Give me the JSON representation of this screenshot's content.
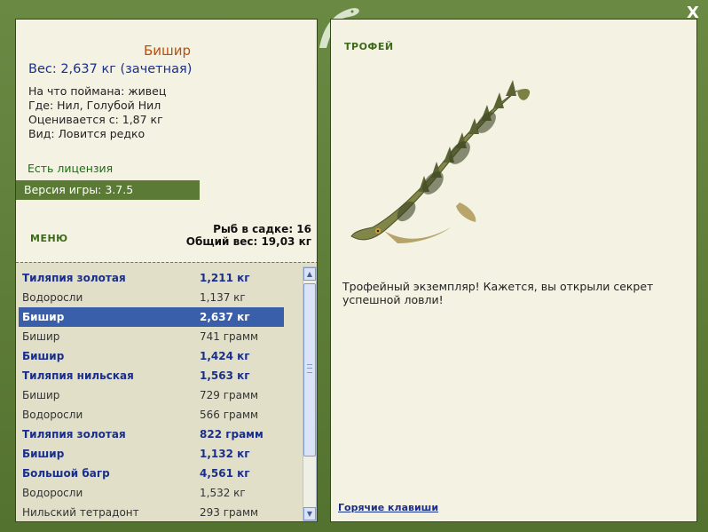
{
  "window": {
    "close_label": "X"
  },
  "fish": {
    "name": "Бишир",
    "weight": "Вес: 2,637 кг (зачетная)",
    "bait": "На что поймана: живец",
    "location": "Где: Нил, Голубой Нил",
    "value": "Оценивается с: 1,87 кг",
    "rarity": "Вид: Ловится редко"
  },
  "license": "Есть лицензия",
  "version": "Версия игры: 3.7.5",
  "menu_label": "МЕНЮ",
  "keepnet": {
    "count": "Рыб в садке: 16",
    "total": "Общий вес: 19,03 кг"
  },
  "catch_list": [
    {
      "name": "Тиляпия золотая",
      "weight": "1,211 кг",
      "style": "b"
    },
    {
      "name": "Водоросли",
      "weight": "1,137 кг",
      "style": "n"
    },
    {
      "name": "Бишир",
      "weight": "2,637 кг",
      "style": "sel"
    },
    {
      "name": "Бишир",
      "weight": "741 грамм",
      "style": "n"
    },
    {
      "name": "Бишир",
      "weight": "1,424 кг",
      "style": "b"
    },
    {
      "name": "Тиляпия нильская",
      "weight": "1,563 кг",
      "style": "b"
    },
    {
      "name": "Бишир",
      "weight": "729 грамм",
      "style": "n"
    },
    {
      "name": "Водоросли",
      "weight": "566 грамм",
      "style": "n"
    },
    {
      "name": "Тиляпия золотая",
      "weight": "822 грамм",
      "style": "b"
    },
    {
      "name": "Бишир",
      "weight": "1,132 кг",
      "style": "b"
    },
    {
      "name": "Большой багр",
      "weight": "4,561 кг",
      "style": "b"
    },
    {
      "name": "Водоросли",
      "weight": "1,532 кг",
      "style": "n"
    },
    {
      "name": "Нильский тетрадонт",
      "weight": "293 грамм",
      "style": "n"
    }
  ],
  "trophy": {
    "label": "ТРОФЕЙ",
    "text": "Трофейный экземпляр! Кажется, вы открыли секрет успешной ловли!"
  },
  "hotkeys_label": "Горячие клавиши",
  "colors": {
    "frame": "#5e7d3c",
    "panel": "#f4f2e3",
    "selection": "#3a5faa",
    "accent_blue": "#1a2f8c"
  }
}
